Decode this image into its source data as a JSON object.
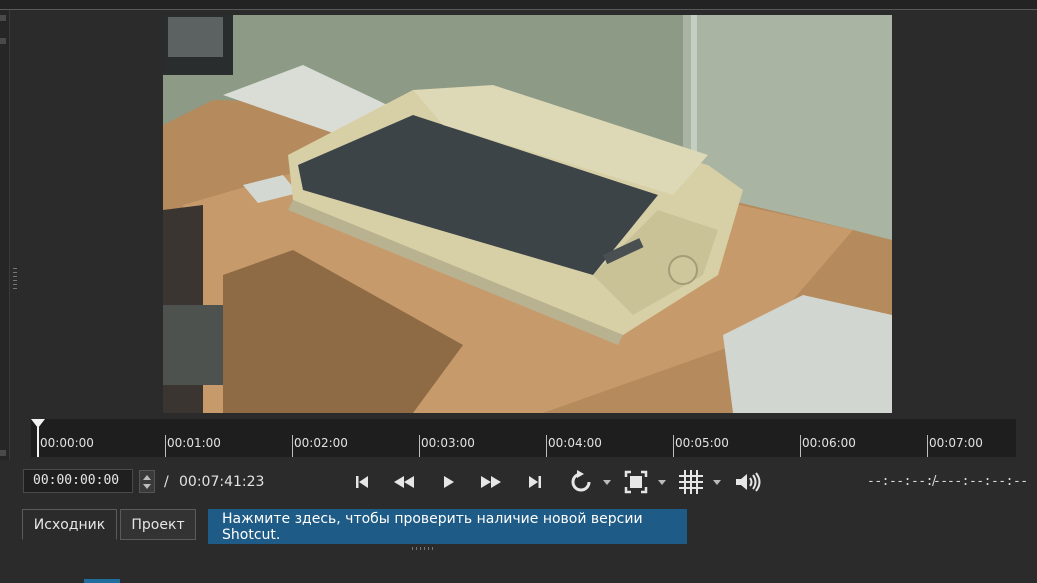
{
  "player": {
    "current_timecode": "00:00:00:00",
    "duration_separator": "/",
    "total_duration": "00:07:41:23",
    "in_point": "--:--:--:--",
    "in_out_separator": "/",
    "out_point": "--:--:--:--"
  },
  "timeline": {
    "ticks": [
      "00:00:00",
      "00:01:00",
      "00:02:00",
      "00:03:00",
      "00:04:00",
      "00:05:00",
      "00:06:00",
      "00:07:00"
    ]
  },
  "transport": {
    "buttons": [
      {
        "name": "skip-to-start-icon"
      },
      {
        "name": "rewind-icon"
      },
      {
        "name": "play-icon"
      },
      {
        "name": "fast-forward-icon"
      },
      {
        "name": "skip-to-end-icon"
      },
      {
        "name": "loop-icon"
      },
      {
        "name": "zoom-fit-icon"
      },
      {
        "name": "grid-icon"
      },
      {
        "name": "volume-icon"
      }
    ]
  },
  "tabs": {
    "source": "Исходник",
    "project": "Проект"
  },
  "update_notice": "Нажмите здесь, чтобы проверить наличие новой версии Shotcut.",
  "colors": {
    "background": "#2b2b2b",
    "ruler": "#1e1e1e",
    "update_banner": "#1e5b86"
  }
}
